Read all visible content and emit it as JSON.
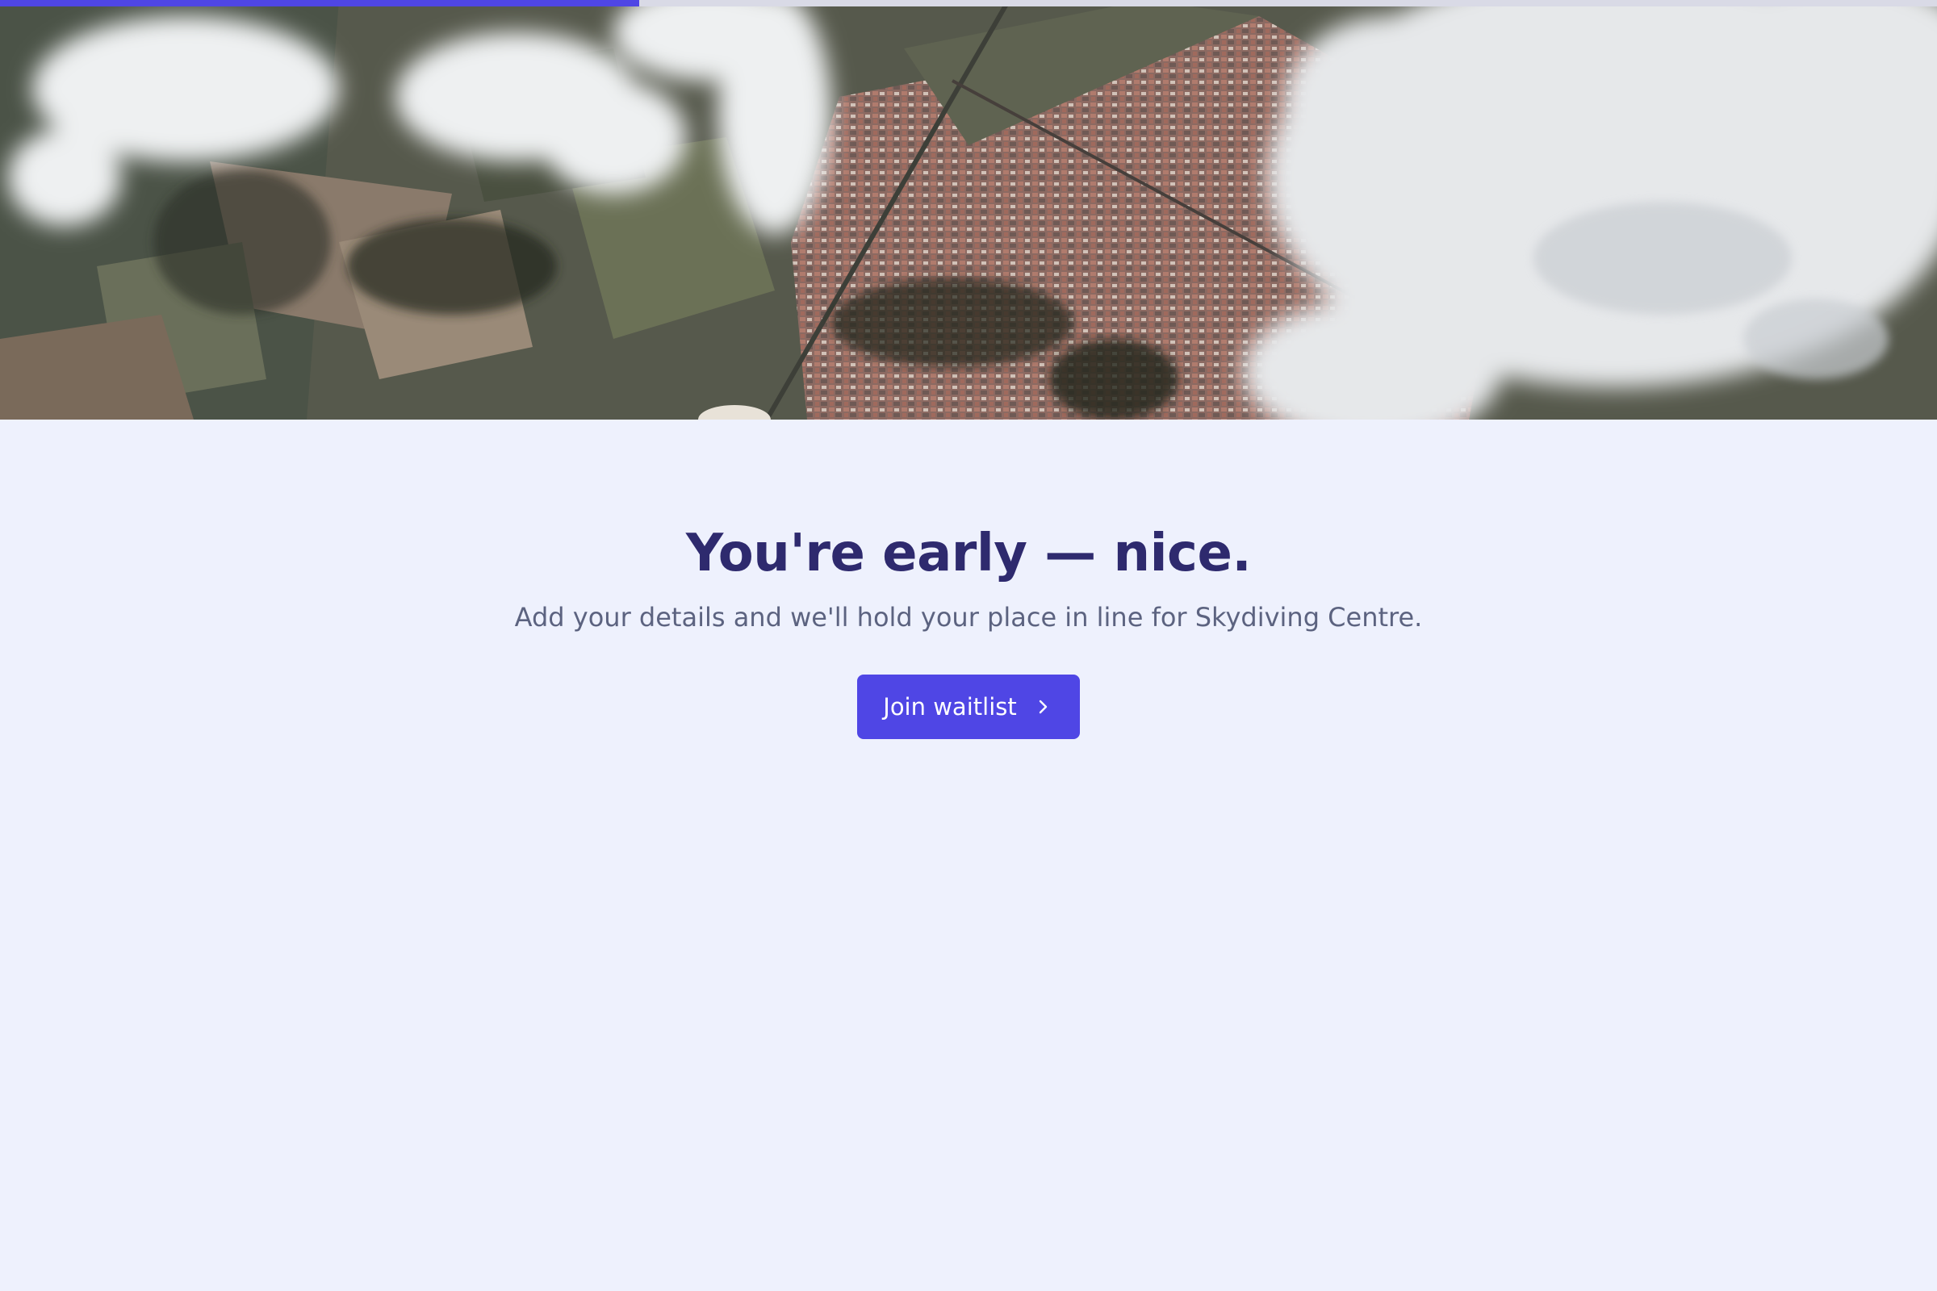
{
  "progress": {
    "fraction": 0.33,
    "color": "#4f46e5"
  },
  "hero": {
    "image": "aerial-landscape-with-clouds-image"
  },
  "main": {
    "title": "You're early — nice.",
    "subtitle": "Add your details and we'll hold your place in line for Skydiving Centre.",
    "cta_label": "Join waitlist",
    "cta_icon": "chevron-right-icon"
  },
  "colors": {
    "page_background": "#eef1fd",
    "title": "#2e2a6e",
    "subtitle": "#5c6380",
    "button": "#4f46e5"
  }
}
